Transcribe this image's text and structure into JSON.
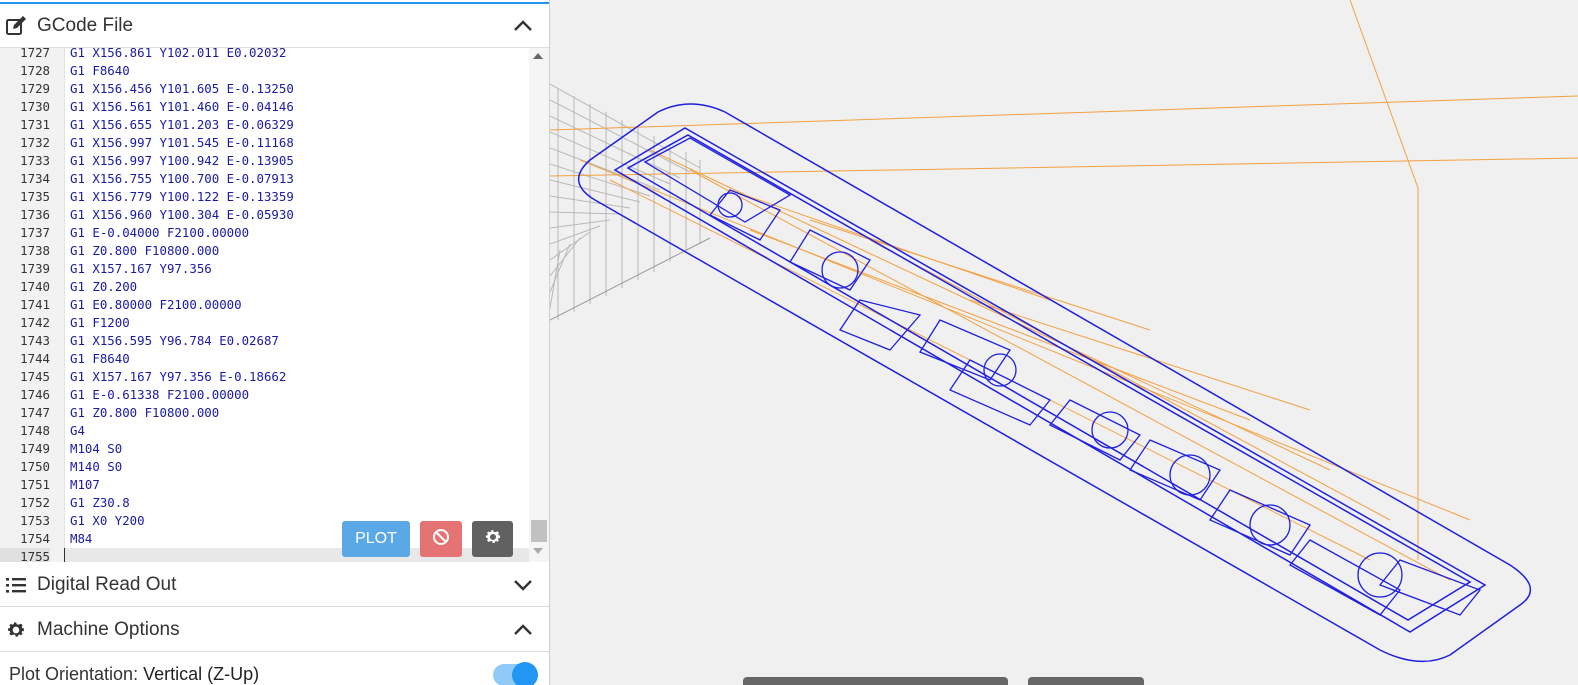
{
  "panels": {
    "gcode": {
      "title": "GCode File",
      "icon": "edit-icon",
      "state": "expanded"
    },
    "dro": {
      "title": "Digital Read Out",
      "icon": "list-icon",
      "state": "collapsed"
    },
    "machine": {
      "title": "Machine Options",
      "icon": "gear-icon",
      "state": "expanded"
    }
  },
  "editor": {
    "lines": [
      {
        "n": "1727",
        "code": "G1 X156.861 Y102.011 E0.02032"
      },
      {
        "n": "1728",
        "code": "G1 F8640"
      },
      {
        "n": "1729",
        "code": "G1 X156.456 Y101.605 E-0.13250"
      },
      {
        "n": "1730",
        "code": "G1 X156.561 Y101.460 E-0.04146"
      },
      {
        "n": "1731",
        "code": "G1 X156.655 Y101.203 E-0.06329"
      },
      {
        "n": "1732",
        "code": "G1 X156.997 Y101.545 E-0.11168"
      },
      {
        "n": "1733",
        "code": "G1 X156.997 Y100.942 E-0.13905"
      },
      {
        "n": "1734",
        "code": "G1 X156.755 Y100.700 E-0.07913"
      },
      {
        "n": "1735",
        "code": "G1 X156.779 Y100.122 E-0.13359"
      },
      {
        "n": "1736",
        "code": "G1 X156.960 Y100.304 E-0.05930"
      },
      {
        "n": "1737",
        "code": "G1 E-0.04000 F2100.00000"
      },
      {
        "n": "1738",
        "code": "G1 Z0.800 F10800.000"
      },
      {
        "n": "1739",
        "code": "G1 X157.167 Y97.356"
      },
      {
        "n": "1740",
        "code": "G1 Z0.200"
      },
      {
        "n": "1741",
        "code": "G1 E0.80000 F2100.00000"
      },
      {
        "n": "1742",
        "code": "G1 F1200"
      },
      {
        "n": "1743",
        "code": "G1 X156.595 Y96.784 E0.02687"
      },
      {
        "n": "1744",
        "code": "G1 F8640"
      },
      {
        "n": "1745",
        "code": "G1 X157.167 Y97.356 E-0.18662"
      },
      {
        "n": "1746",
        "code": "G1 E-0.61338 F2100.00000"
      },
      {
        "n": "1747",
        "code": "G1 Z0.800 F10800.000"
      },
      {
        "n": "1748",
        "code": "G4"
      },
      {
        "n": "1749",
        "code": "M104 S0"
      },
      {
        "n": "1750",
        "code": "M140 S0"
      },
      {
        "n": "1751",
        "code": "M107"
      },
      {
        "n": "1752",
        "code": "G1 Z30.8"
      },
      {
        "n": "1753",
        "code": "G1 X0 Y200"
      },
      {
        "n": "1754",
        "code": "M84"
      },
      {
        "n": "1755",
        "code": ""
      }
    ],
    "active_line": "1755"
  },
  "buttons": {
    "plot": "PLOT",
    "cancel_icon": "cancel-icon",
    "settings_icon": "gear-icon"
  },
  "machine_options": {
    "plot_orientation_label": "Plot Orientation:",
    "plot_orientation_value": "Vertical (Z-Up)",
    "toggle_on": true
  },
  "colors": {
    "accent": "#2196f3",
    "plot_button": "#5aa9e6",
    "cancel_button": "#e57373",
    "settings_button": "#616161",
    "code_text": "#1a1aa6",
    "toolpath_outline": "#1f1fe0",
    "travel_moves": "#f5a040"
  }
}
